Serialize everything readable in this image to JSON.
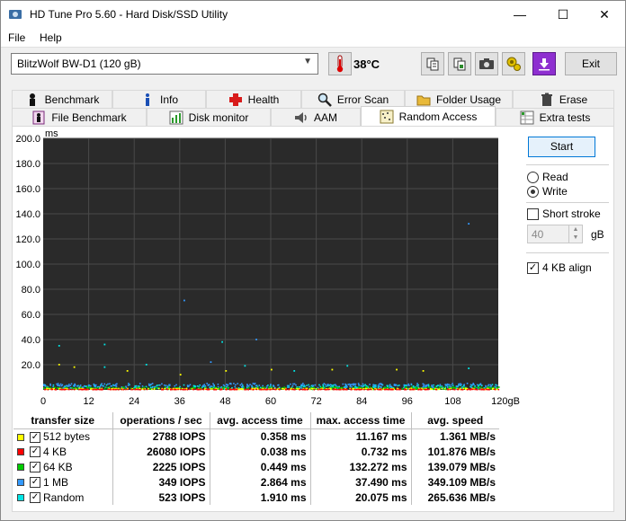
{
  "window": {
    "title": "HD Tune Pro 5.60 - Hard Disk/SSD Utility",
    "min_glyph": "—",
    "max_glyph": "☐",
    "close_glyph": "✕"
  },
  "menu": [
    "File",
    "Help"
  ],
  "toolbar": {
    "drive": "BlitzWolf BW-D1 (120 gB)",
    "temperature": "38°C",
    "exit_label": "Exit",
    "icons": [
      "thermometer-icon",
      "copy-text-icon",
      "copy-screenshot-icon",
      "camera-icon",
      "options-icon",
      "save-icon"
    ]
  },
  "tabs": {
    "row1": [
      "Benchmark",
      "Info",
      "Health",
      "Error Scan",
      "Folder Usage",
      "Erase"
    ],
    "row2": [
      "File Benchmark",
      "Disk monitor",
      "AAM",
      "Random Access",
      "Extra tests"
    ],
    "active": "Random Access"
  },
  "controls": {
    "start_label": "Start",
    "read_label": "Read",
    "write_label": "Write",
    "mode": "Write",
    "short_stroke_label": "Short stroke",
    "short_stroke_checked": false,
    "short_stroke_value": "40",
    "short_stroke_unit": "gB",
    "align_label": "4 KB align",
    "align_checked": true
  },
  "chart_data": {
    "type": "scatter",
    "y_unit_label": "ms",
    "x_unit_label": "gB",
    "ylim": [
      0,
      200
    ],
    "xlim": [
      0,
      120
    ],
    "y_ticks": [
      "200.0",
      "180.0",
      "160.0",
      "140.0",
      "120.0",
      "100.0",
      "80.0",
      "60.0",
      "40.0",
      "20.0"
    ],
    "x_ticks": [
      "0",
      "12",
      "24",
      "36",
      "48",
      "60",
      "72",
      "84",
      "96",
      "108",
      "120gB"
    ],
    "background": "#2a2a2a",
    "grid": true,
    "series": [
      {
        "name": "512 bytes",
        "color": "#ffff00",
        "band": [
          0.2,
          1.0
        ]
      },
      {
        "name": "4 KB",
        "color": "#ff0000",
        "band": [
          0.02,
          0.3
        ]
      },
      {
        "name": "64 KB",
        "color": "#00cc00",
        "band": [
          0.2,
          2.0
        ]
      },
      {
        "name": "1 MB",
        "color": "#3399ff",
        "band": [
          1.5,
          5
        ]
      },
      {
        "name": "Random",
        "color": "#00e5e5",
        "band": [
          0.3,
          4
        ]
      }
    ],
    "outliers": [
      {
        "x": 4,
        "y": 20,
        "s": "#ffff00"
      },
      {
        "x": 8,
        "y": 18,
        "s": "#ffff00"
      },
      {
        "x": 16,
        "y": 18,
        "s": "#00e5e5"
      },
      {
        "x": 22,
        "y": 15,
        "s": "#ffff00"
      },
      {
        "x": 27,
        "y": 20,
        "s": "#00e5e5"
      },
      {
        "x": 36,
        "y": 12,
        "s": "#ffff00"
      },
      {
        "x": 44,
        "y": 22,
        "s": "#3399ff"
      },
      {
        "x": 48,
        "y": 15,
        "s": "#ffff00"
      },
      {
        "x": 53,
        "y": 19,
        "s": "#00e5e5"
      },
      {
        "x": 60,
        "y": 16,
        "s": "#ffff00"
      },
      {
        "x": 66,
        "y": 15,
        "s": "#00e5e5"
      },
      {
        "x": 76,
        "y": 16,
        "s": "#ffff00"
      },
      {
        "x": 80,
        "y": 19,
        "s": "#00e5e5"
      },
      {
        "x": 93,
        "y": 16,
        "s": "#ffff00"
      },
      {
        "x": 100,
        "y": 15,
        "s": "#ffff00"
      },
      {
        "x": 112,
        "y": 17,
        "s": "#00e5e5"
      },
      {
        "x": 4,
        "y": 35,
        "s": "#00e5e5"
      },
      {
        "x": 16,
        "y": 36,
        "s": "#00e5e5"
      },
      {
        "x": 47,
        "y": 38,
        "s": "#00e5e5"
      },
      {
        "x": 37,
        "y": 71,
        "s": "#3399ff"
      },
      {
        "x": 56,
        "y": 40,
        "s": "#3399ff"
      },
      {
        "x": 112,
        "y": 132,
        "s": "#3399ff"
      }
    ]
  },
  "results": {
    "headers": [
      "transfer size",
      "operations / sec",
      "avg. access time",
      "max. access time",
      "avg. speed"
    ],
    "rows": [
      {
        "label": "512 bytes",
        "color": "#ffff00",
        "ops": "2788 IOPS",
        "avg": "0.358 ms",
        "max": "11.167 ms",
        "speed": "1.361 MB/s"
      },
      {
        "label": "4 KB",
        "color": "#ff0000",
        "ops": "26080 IOPS",
        "avg": "0.038 ms",
        "max": "0.732 ms",
        "speed": "101.876 MB/s"
      },
      {
        "label": "64 KB",
        "color": "#00cc00",
        "ops": "2225 IOPS",
        "avg": "0.449 ms",
        "max": "132.272 ms",
        "speed": "139.079 MB/s"
      },
      {
        "label": "1 MB",
        "color": "#3399ff",
        "ops": "349 IOPS",
        "avg": "2.864 ms",
        "max": "37.490 ms",
        "speed": "349.109 MB/s"
      },
      {
        "label": "Random",
        "color": "#00e5e5",
        "ops": "523 IOPS",
        "avg": "1.910 ms",
        "max": "20.075 ms",
        "speed": "265.636 MB/s"
      }
    ]
  }
}
